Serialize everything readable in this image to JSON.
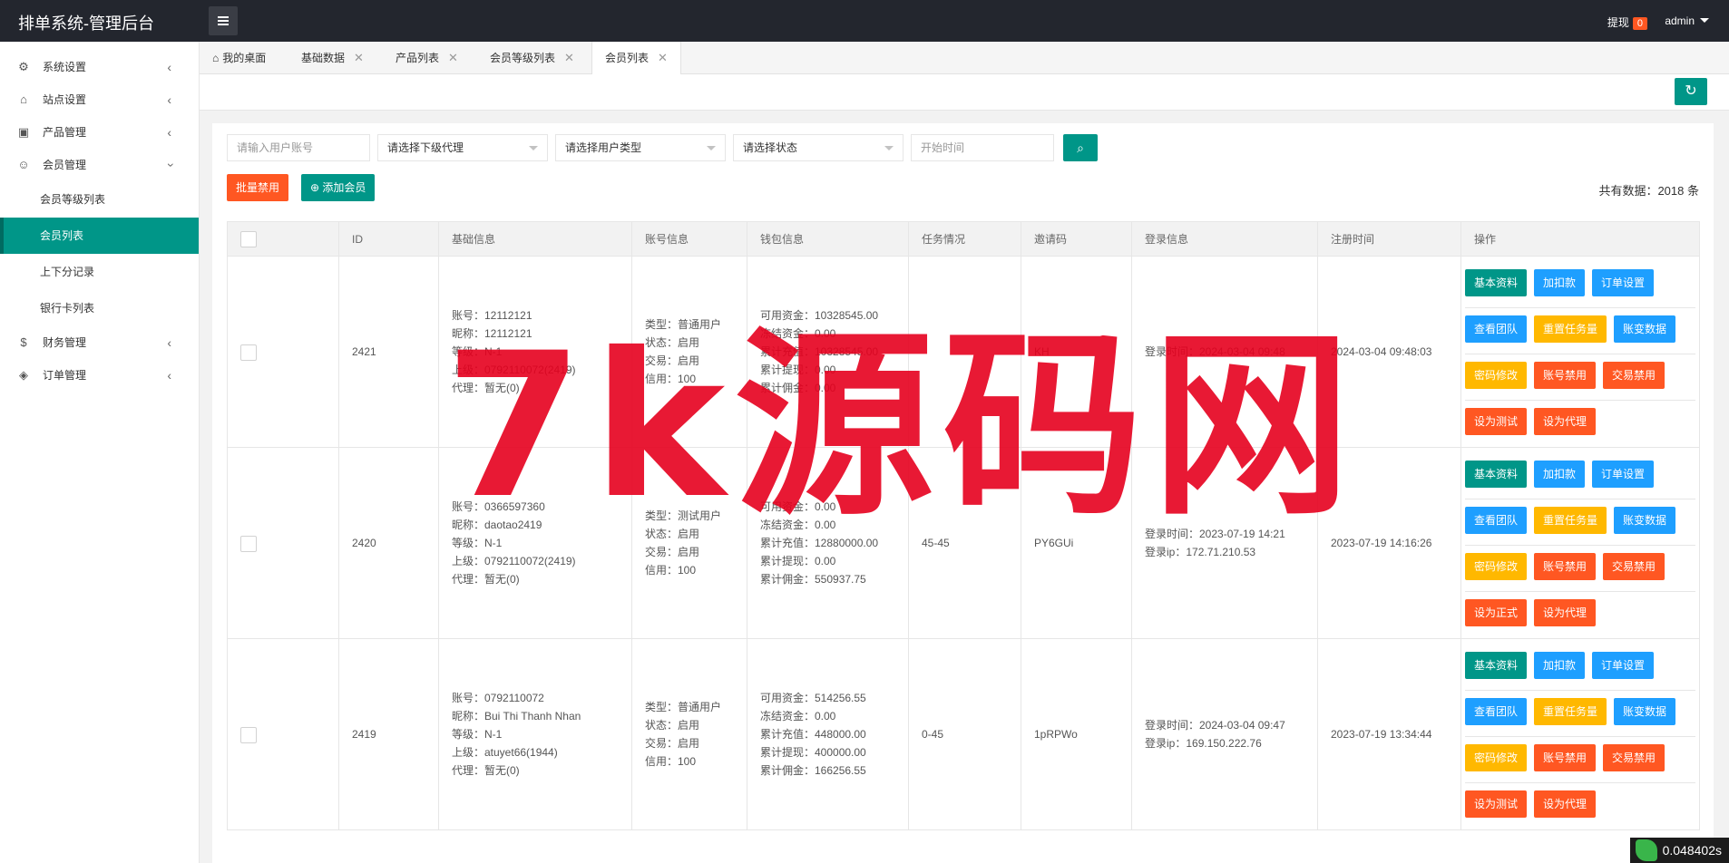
{
  "app": {
    "title": "排单系统-管理后台"
  },
  "topbar": {
    "withdraw_label": "提现",
    "withdraw_count": "0",
    "user": "admin"
  },
  "sidebar": {
    "items": [
      {
        "label": "系统设置",
        "icon": "gear-icon"
      },
      {
        "label": "站点设置",
        "icon": "home-icon"
      },
      {
        "label": "产品管理",
        "icon": "box-icon"
      },
      {
        "label": "会员管理",
        "icon": "user-icon"
      },
      {
        "label": "财务管理",
        "icon": "dollar-icon"
      },
      {
        "label": "订单管理",
        "icon": "cube-icon"
      }
    ],
    "sub_items": [
      {
        "label": "会员等级列表"
      },
      {
        "label": "会员列表"
      },
      {
        "label": "上下分记录"
      },
      {
        "label": "银行卡列表"
      }
    ]
  },
  "tabs": [
    {
      "label": "我的桌面"
    },
    {
      "label": "基础数据"
    },
    {
      "label": "产品列表"
    },
    {
      "label": "会员等级列表"
    },
    {
      "label": "会员列表"
    }
  ],
  "filters": {
    "account_placeholder": "请输入用户账号",
    "agent": "请选择下级代理",
    "user_type": "请选择用户类型",
    "status": "请选择状态",
    "start_time_placeholder": "开始时间"
  },
  "actions": {
    "batch_disable": "批量禁用",
    "add_member": "添加会员",
    "total": "共有数据：2018 条"
  },
  "table": {
    "headers": [
      "ID",
      "基础信息",
      "账号信息",
      "钱包信息",
      "任务情况",
      "邀请码",
      "登录信息",
      "注册时间",
      "操作"
    ],
    "rows": [
      {
        "id": "2421",
        "basic": [
          "账号：12112121",
          "昵称：12112121",
          "等级：N-1",
          "上级：0792110072(2419)",
          "代理：暂无(0)"
        ],
        "account": [
          "类型：普通用户",
          "状态：启用",
          "交易：启用",
          "信用：100"
        ],
        "wallet": [
          "可用资金：10328545.00",
          "冻结资金：0.00",
          "累计充值：10328545.00",
          "累计提现：0.00",
          "累计佣金：0.00"
        ],
        "task": "",
        "invite": "KH",
        "login": [
          "登录时间：2024-03-04 09:48",
          ""
        ],
        "reg": "2024-03-04 09:48:03",
        "test_btn": "设为测试"
      },
      {
        "id": "2420",
        "basic": [
          "账号：0366597360",
          "昵称：daotao2419",
          "等级：N-1",
          "上级：0792110072(2419)",
          "代理：暂无(0)"
        ],
        "account": [
          "类型：测试用户",
          "状态：启用",
          "交易：启用",
          "信用：100"
        ],
        "wallet": [
          "可用资金：0.00",
          "冻结资金：0.00",
          "累计充值：12880000.00",
          "累计提现：0.00",
          "累计佣金：550937.75"
        ],
        "task": "45-45",
        "invite": "PY6GUi",
        "login": [
          "登录时间：2023-07-19 14:21",
          "登录ip：172.71.210.53"
        ],
        "reg": "2023-07-19 14:16:26",
        "test_btn": "设为正式"
      },
      {
        "id": "2419",
        "basic": [
          "账号：0792110072",
          "昵称：Bui Thi Thanh Nhan",
          "等级：N-1",
          "上级：atuyet66(1944)",
          "代理：暂无(0)"
        ],
        "account": [
          "类型：普通用户",
          "状态：启用",
          "交易：启用",
          "信用：100"
        ],
        "wallet": [
          "可用资金：514256.55",
          "冻结资金：0.00",
          "累计充值：448000.00",
          "累计提现：400000.00",
          "累计佣金：166256.55"
        ],
        "task": "0-45",
        "invite": "1pRPWo",
        "login": [
          "登录时间：2024-03-04 09:47",
          "登录ip：169.150.222.76"
        ],
        "reg": "2023-07-19 13:34:44",
        "test_btn": "设为测试"
      }
    ],
    "ops": {
      "basic": "基本资料",
      "addsub": "加扣款",
      "order": "订单设置",
      "team": "查看团队",
      "reset": "重置任务量",
      "ledger": "账变数据",
      "pwd": "密码修改",
      "acct_ban": "账号禁用",
      "trade_ban": "交易禁用",
      "agent": "设为代理"
    }
  },
  "watermark": "7k源码网",
  "timer": "0.048402s",
  "colors": {
    "teal": "#009688",
    "blue": "#1e9fff",
    "orange": "#ffb800",
    "red": "#ff5722",
    "topbar": "#23262e"
  }
}
